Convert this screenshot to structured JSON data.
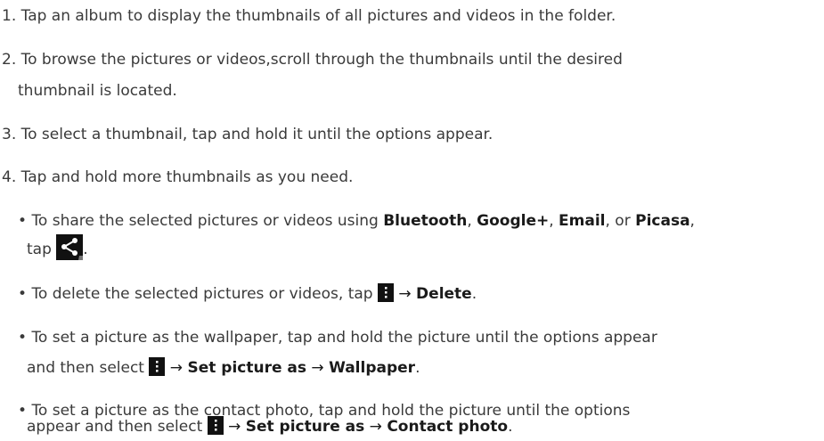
{
  "step1": "1. Tap an album to display the thumbnails of all pictures and videos in the folder.",
  "step2a": "2. To browse the pictures or videos,scroll through the thumbnails until the desired",
  "step2b": "thumbnail is located.",
  "step3": "3. To select a thumbnail, tap and hold it until the options appear.",
  "step4": "4. Tap and hold more thumbnails as you need.",
  "bullet": "•",
  "arrow": "→",
  "share": {
    "pre": "To share the selected pictures or videos using ",
    "bluetooth": "Bluetooth",
    "sep1": ", ",
    "googleplus": "Google+",
    "sep2": ", ",
    "email": "Email",
    "sep3": ", or ",
    "picasa": "Picasa",
    "sep4": ",",
    "tap": "tap",
    "end": "."
  },
  "delete": {
    "pre": "To delete the selected pictures or videos, tap",
    "label": "Delete",
    "end": "."
  },
  "wallpaper": {
    "line1": "To set a picture as the wallpaper, tap and hold the picture until the options appear",
    "pre": "and then select",
    "setas": "Set picture as",
    "label": "Wallpaper",
    "end": "."
  },
  "contact": {
    "line1": "To set a picture as the contact photo, tap and hold the picture until the options",
    "pre": "appear and then select",
    "setas": "Set picture as",
    "label": "Contact photo",
    "end": "."
  },
  "icons": {
    "share": "share-icon",
    "menu": "menu-icon"
  },
  "colors": {
    "text": "#3a3a3a",
    "icon_bg": "#111111"
  }
}
